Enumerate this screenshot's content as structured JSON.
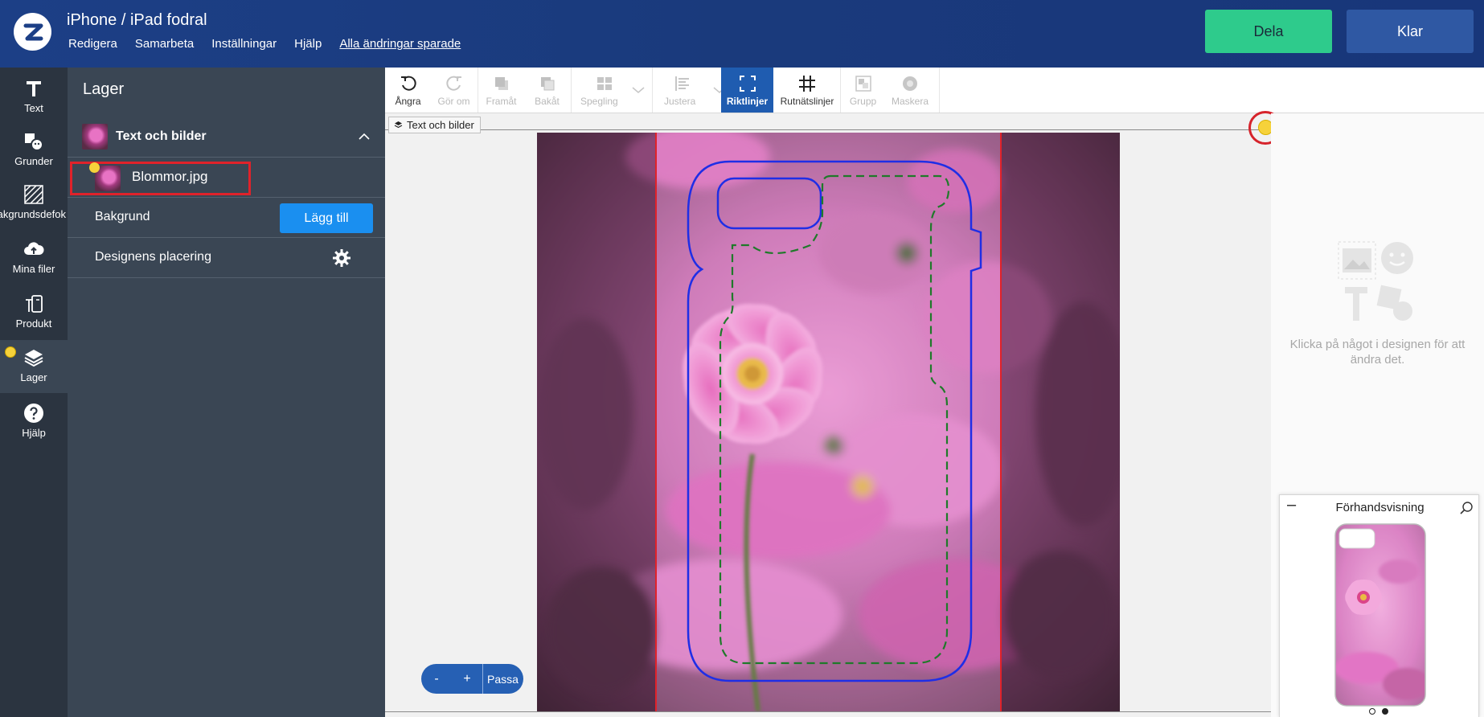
{
  "header": {
    "title": "iPhone / iPad fodral",
    "menu": [
      "Redigera",
      "Samarbeta",
      "Inställningar",
      "Hjälp"
    ],
    "saved_status": "Alla ändringar sparade",
    "share_label": "Dela",
    "done_label": "Klar"
  },
  "rail": {
    "items": [
      {
        "label": "Text",
        "icon": "text-icon"
      },
      {
        "label": "Grunder",
        "icon": "shapes-icon"
      },
      {
        "label": "Bakgrundsdefok",
        "icon": "background-icon"
      },
      {
        "label": "Mina filer",
        "icon": "cloud-upload-icon"
      },
      {
        "label": "Produkt",
        "icon": "product-icon"
      },
      {
        "label": "Lager",
        "icon": "layers-icon"
      },
      {
        "label": "Hjälp",
        "icon": "help-icon"
      }
    ]
  },
  "layers_panel": {
    "title": "Lager",
    "group_label": "Text och bilder",
    "layer_name": "Blommor.jpg",
    "background_label": "Bakgrund",
    "add_button": "Lägg till",
    "placement_label": "Designens placering"
  },
  "toolbar": {
    "tools": [
      {
        "label": "Ångra",
        "state": "enabled"
      },
      {
        "label": "Gör om",
        "state": "disabled"
      },
      {
        "label": "Framåt",
        "state": "disabled"
      },
      {
        "label": "Bakåt",
        "state": "disabled"
      },
      {
        "label": "Spegling",
        "state": "disabled"
      },
      {
        "label": "Justera",
        "state": "disabled"
      },
      {
        "label": "Riktlinjer",
        "state": "active"
      },
      {
        "label": "Rutnätslinjer",
        "state": "enabled"
      },
      {
        "label": "Grupp",
        "state": "disabled"
      },
      {
        "label": "Maskera",
        "state": "disabled"
      }
    ]
  },
  "canvas": {
    "layer_tag": "Text och bilder",
    "zoom_minus": "-",
    "zoom_plus": "+",
    "zoom_fit": "Passa"
  },
  "right_panel": {
    "hint": "Klicka på något i designen för att ändra det.",
    "preview_title": "Förhandsvisning",
    "preview_page_count": 2,
    "preview_active_page": 2
  },
  "colors": {
    "header_bg": "#1c3f86",
    "share_green": "#2ecb8c",
    "done_blue": "#2f58a3",
    "rail_bg": "#2b3440",
    "panel_bg": "#3a4654",
    "accent_blue": "#1a8ff0",
    "active_tool": "#1f5cb0",
    "warning_red": "#d6232b",
    "warning_yellow": "#f6d23a"
  }
}
